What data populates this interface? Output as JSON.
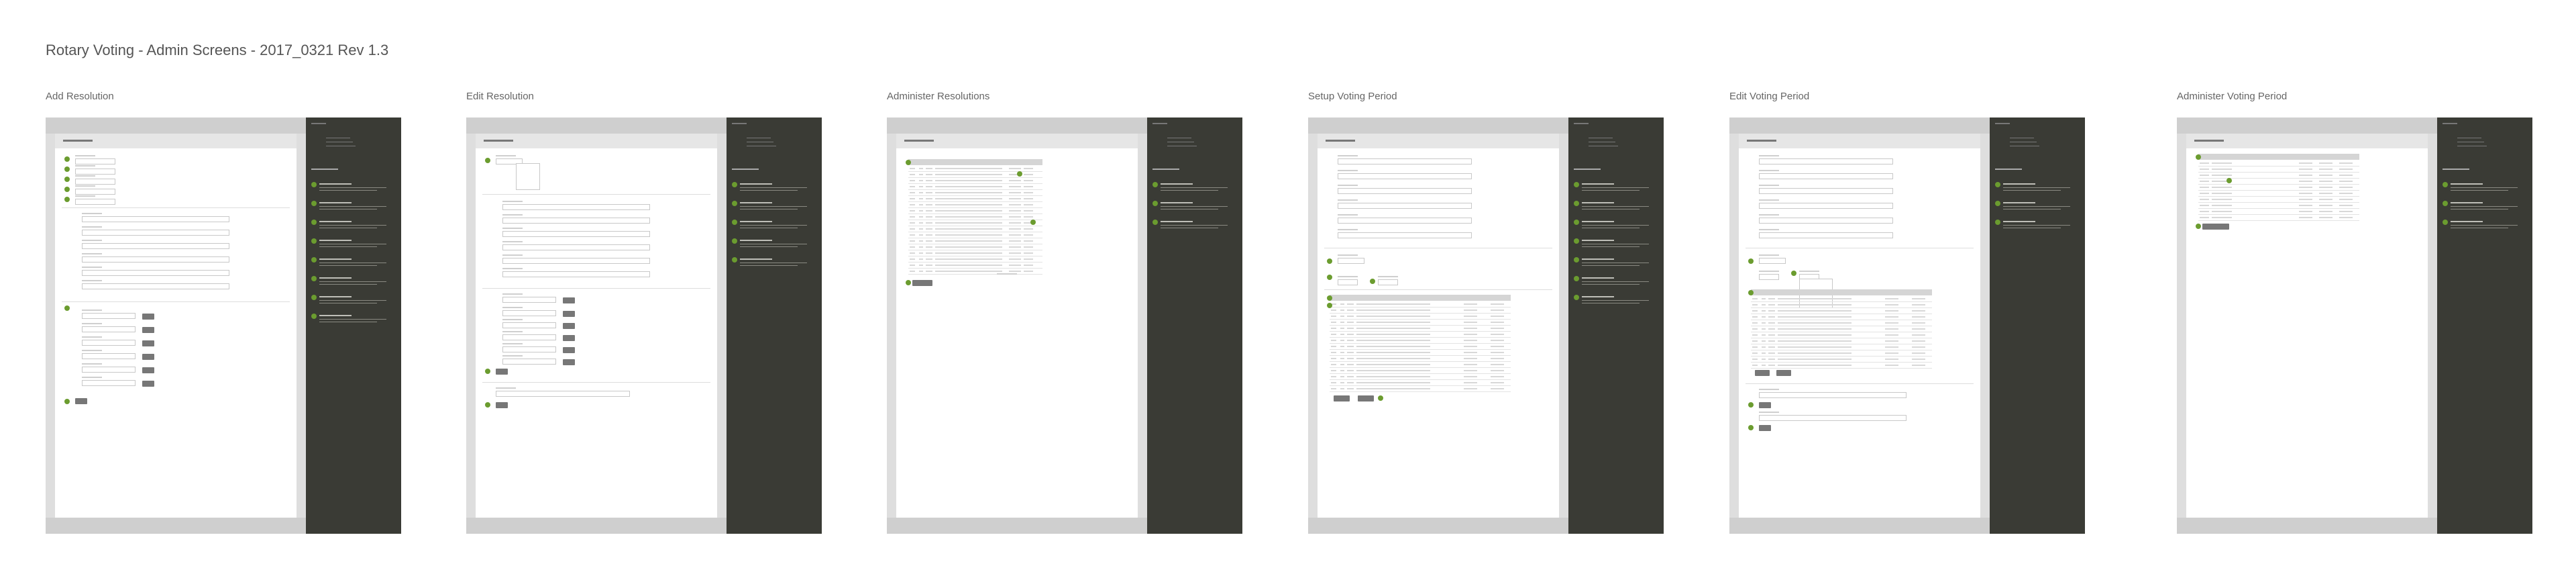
{
  "header": {
    "title": "Rotary Voting - Admin Screens - 2017_0321 Rev 1.3"
  },
  "screens": [
    {
      "title": "Add Resolution"
    },
    {
      "title": "Edit Resolution"
    },
    {
      "title": "Administer Resolutions"
    },
    {
      "title": "Setup Voting Period"
    },
    {
      "title": "Edit Voting Period"
    },
    {
      "title": "Administer Voting Period"
    }
  ],
  "colors": {
    "accent": "#6b9c2f",
    "notes_bg": "#3a3b35",
    "frame": "#dedede"
  }
}
